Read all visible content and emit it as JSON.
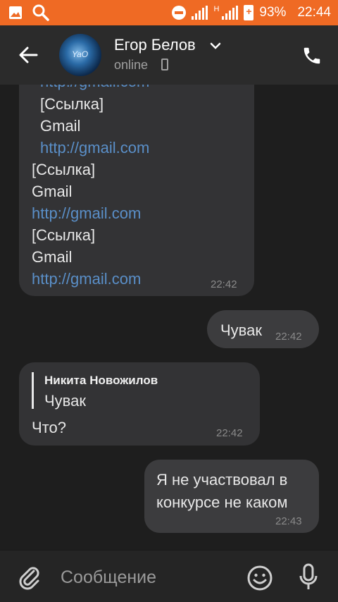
{
  "statusbar": {
    "battery": "93%",
    "time": "22:44",
    "network_letter": "H",
    "icons": [
      "image-icon",
      "search-icon",
      "do-not-disturb-icon",
      "signal-icon",
      "battery-icon"
    ]
  },
  "header": {
    "contact_name": "Егор Белов",
    "presence": "online",
    "icons": [
      "back-arrow-icon",
      "chevron-down-icon",
      "mobile-device-icon",
      "phone-icon"
    ]
  },
  "messages": {
    "m1": {
      "lines": [
        "http://gmail.com",
        "[Ссылка]",
        "Gmail",
        "http://gmail.com",
        "[Ссылка]",
        "Gmail",
        "http://gmail.com",
        "[Ссылка]",
        "Gmail",
        "http://gmail.com"
      ],
      "time": "22:42"
    },
    "m2": {
      "text": "Чувак",
      "time": "22:42"
    },
    "m3": {
      "reply_author": "Никита Новожилов",
      "reply_text": "Чувак",
      "text": "Что?",
      "time": "22:42"
    },
    "m4": {
      "lines": [
        "Я не участвовал в",
        "конкурсе не каком"
      ],
      "time": "22:43"
    }
  },
  "composer": {
    "placeholder": "Сообщение",
    "icons": [
      "attach-clip-icon",
      "emoji-icon",
      "microphone-icon"
    ]
  }
}
